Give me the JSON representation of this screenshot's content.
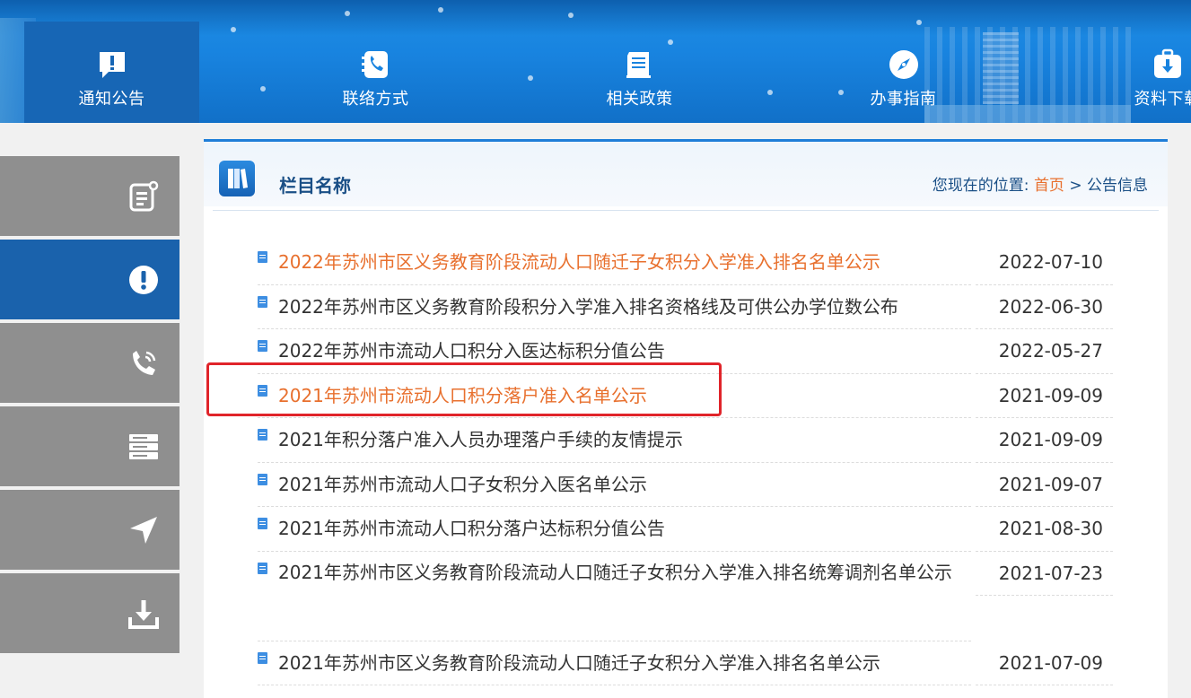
{
  "nav": {
    "items": [
      {
        "label": "通知公告",
        "icon": "notice-icon"
      },
      {
        "label": "联络方式",
        "icon": "phone-icon"
      },
      {
        "label": "相关政策",
        "icon": "document-icon"
      },
      {
        "label": "办事指南",
        "icon": "compass-icon"
      },
      {
        "label": "资料下载",
        "icon": "download-icon"
      }
    ],
    "active_index": 0
  },
  "sidebar": {
    "items": [
      {
        "icon": "notepad-icon"
      },
      {
        "icon": "alert-icon"
      },
      {
        "icon": "phone-icon"
      },
      {
        "icon": "server-icon"
      },
      {
        "icon": "send-icon"
      },
      {
        "icon": "download-icon"
      }
    ],
    "active_index": 1
  },
  "panel": {
    "title": "栏目名称",
    "breadcrumb": {
      "prefix": "您现在的位置:",
      "home": "首页",
      "separator": ">",
      "current": "公告信息"
    }
  },
  "articles": [
    {
      "title": "2022年苏州市区义务教育阶段流动人口随迁子女积分入学准入排名名单公示",
      "date": "2022-07-10",
      "highlighted": true
    },
    {
      "title": "2022年苏州市区义务教育阶段积分入学准入排名资格线及可供公办学位数公布",
      "date": "2022-06-30",
      "highlighted": false
    },
    {
      "title": "2022年苏州市流动人口积分入医达标积分值公告",
      "date": "2022-05-27",
      "highlighted": false
    },
    {
      "title": "2021年苏州市流动人口积分落户准入名单公示",
      "date": "2021-09-09",
      "highlighted": true
    },
    {
      "title": "2021年积分落户准入人员办理落户手续的友情提示",
      "date": "2021-09-09",
      "highlighted": false
    },
    {
      "title": "2021年苏州市流动人口子女积分入医名单公示",
      "date": "2021-09-07",
      "highlighted": false
    },
    {
      "title": "2021年苏州市流动人口积分落户达标积分值公告",
      "date": "2021-08-30",
      "highlighted": false
    },
    {
      "title": "2021年苏州市区义务教育阶段流动人口随迁子女积分入学准入排名统筹调剂名单公示",
      "date": "2021-07-23",
      "highlighted": false
    },
    {
      "title": "2021年苏州市区义务教育阶段流动人口随迁子女积分入学准入排名名单公示",
      "date": "2021-07-09",
      "highlighted": false
    }
  ],
  "colors": {
    "nav_bg": "#1883df",
    "nav_active": "#1766b5",
    "sidebar_bg": "#8f8f8f",
    "sidebar_active": "#1a62ac",
    "link_highlight": "#e8702e",
    "annotation_box": "#e0242a"
  }
}
